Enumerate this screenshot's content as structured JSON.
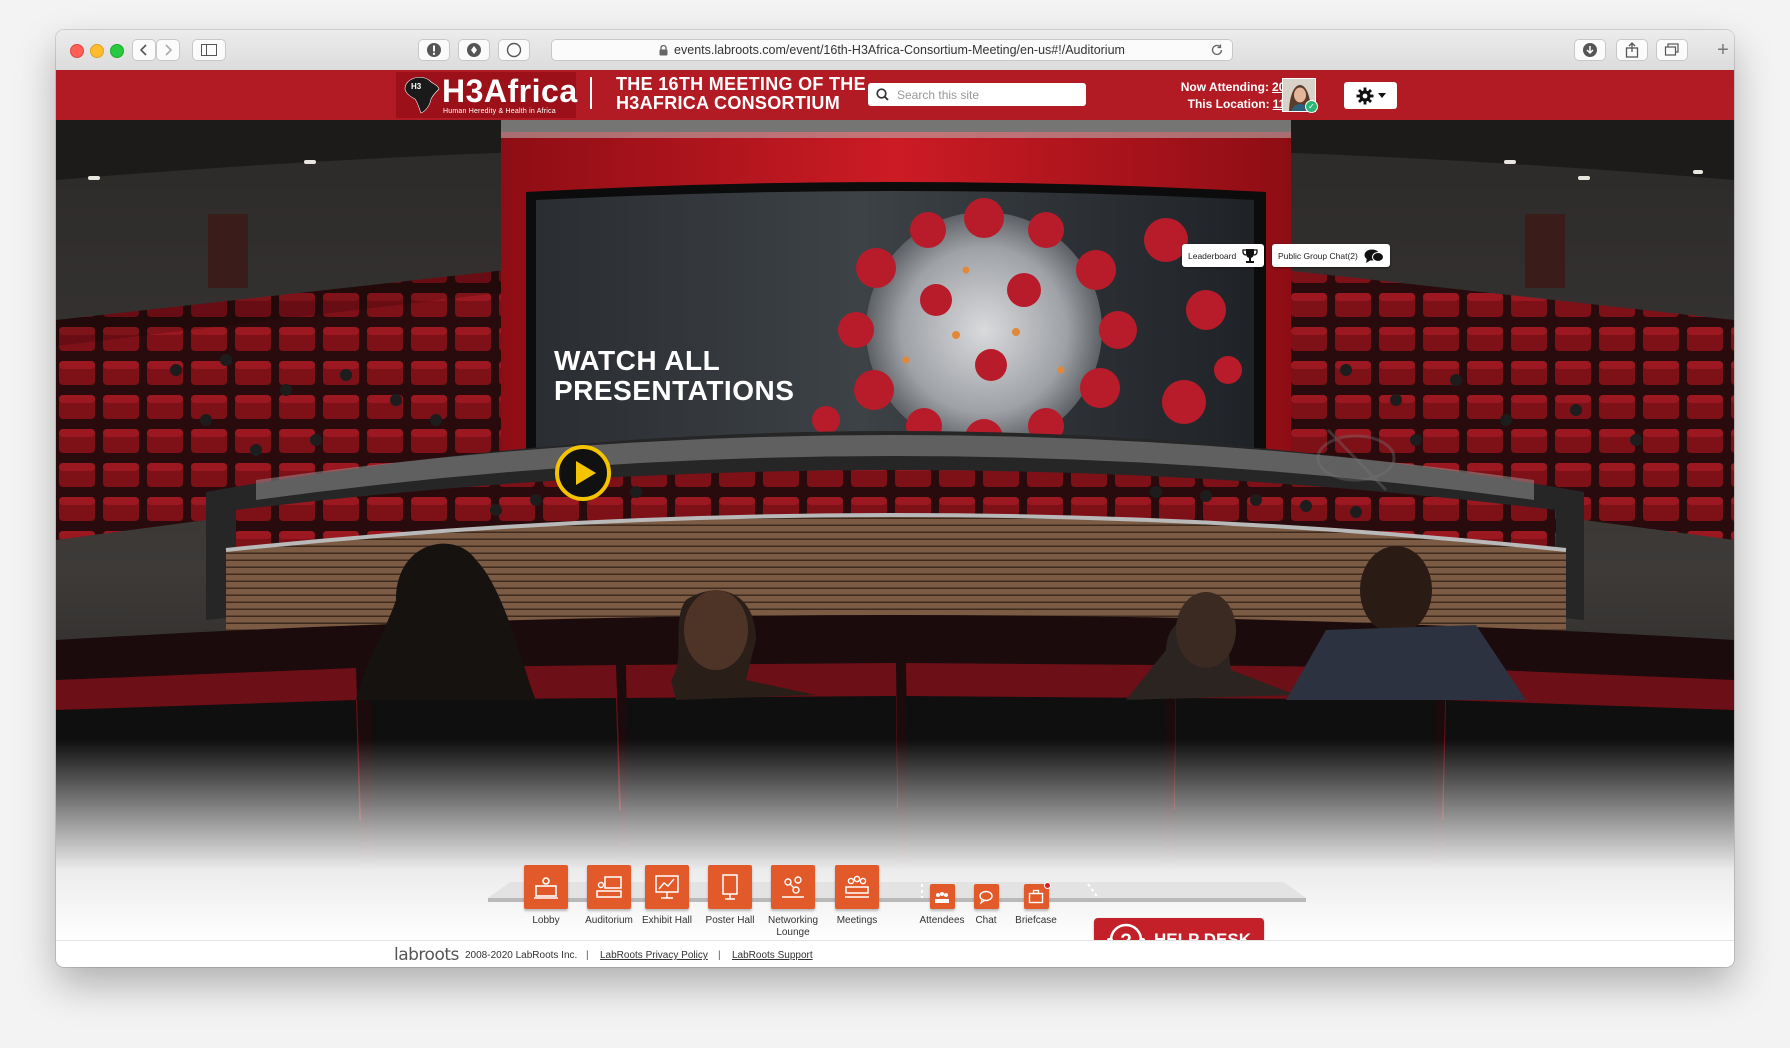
{
  "browser": {
    "url": "events.labroots.com/event/16th-H3Africa-Consortium-Meeting/en-us#!/Auditorium"
  },
  "header": {
    "logo_title": "H3Africa",
    "logo_subtitle": "Human Heredity & Health in Africa",
    "event_title_line1": "THE 16TH MEETING OF THE",
    "event_title_line2": "H3AFRICA CONSORTIUM",
    "search_placeholder": "Search this site",
    "now_attending_label": "Now Attending:",
    "now_attending_count": "202",
    "this_location_label": "This Location:",
    "this_location_count": "113"
  },
  "floating_buttons": {
    "leaderboard": "Leaderboard",
    "public_chat": "Public Group Chat(2)"
  },
  "screen": {
    "line1": "WATCH ALL",
    "line2": "PRESENTATIONS"
  },
  "nav": {
    "main": [
      {
        "label": "Lobby"
      },
      {
        "label": "Auditorium"
      },
      {
        "label": "Exhibit Hall"
      },
      {
        "label": "Poster Hall"
      },
      {
        "label": "Networking",
        "label2": "Lounge"
      },
      {
        "label": "Meetings"
      }
    ],
    "tools": [
      {
        "label": "Attendees"
      },
      {
        "label": "Chat"
      },
      {
        "label": "Briefcase"
      }
    ],
    "help_desk": "HELP DESK"
  },
  "footer": {
    "brand": "labroots",
    "copyright": "2008-2020 LabRoots Inc.",
    "privacy": "LabRoots Privacy Policy",
    "support": "LabRoots Support"
  },
  "colors": {
    "header_red": "#b31b24",
    "nav_orange": "#e25a2a",
    "play_yellow": "#f5c400"
  }
}
